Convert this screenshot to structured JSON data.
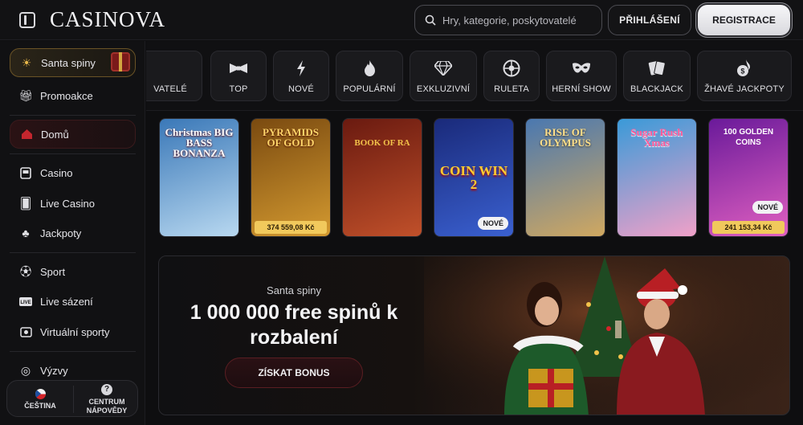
{
  "header": {
    "logo": "CASINOVA",
    "search_placeholder": "Hry, kategorie, poskytovatelé",
    "login_label": "PŘIHLÁŠENÍ",
    "register_label": "REGISTRACE"
  },
  "sidebar": {
    "items": [
      {
        "label": "Santa spiny",
        "icon": "sun-icon"
      },
      {
        "label": "Promoakce",
        "icon": "gift-icon"
      },
      {
        "label": "Domů",
        "icon": "home-icon"
      },
      {
        "label": "Casino",
        "icon": "slot-machine-icon"
      },
      {
        "label": "Live Casino",
        "icon": "live-cards-icon"
      },
      {
        "label": "Jackpoty",
        "icon": "clover-icon"
      },
      {
        "label": "Sport",
        "icon": "soccer-ball-icon"
      },
      {
        "label": "Live sázení",
        "icon": "live-badge-icon"
      },
      {
        "label": "Virtuální sporty",
        "icon": "virtual-sport-icon"
      },
      {
        "label": "Výzvy",
        "icon": "target-icon"
      }
    ],
    "language_label": "ČEŠTINA",
    "help_label_line1": "CENTRUM",
    "help_label_line2": "NÁPOVĚDY"
  },
  "categories": [
    {
      "label": "VATELÉ",
      "icon": "none"
    },
    {
      "label": "TOP",
      "icon": "bowtie-icon"
    },
    {
      "label": "NOVÉ",
      "icon": "lightning-icon"
    },
    {
      "label": "POPULÁRNÍ",
      "icon": "flame-icon"
    },
    {
      "label": "EXKLUZIVNÍ",
      "icon": "diamond-icon"
    },
    {
      "label": "RULETA",
      "icon": "roulette-icon"
    },
    {
      "label": "HERNÍ SHOW",
      "icon": "mask-icon"
    },
    {
      "label": "BLACKJACK",
      "icon": "cards-icon"
    },
    {
      "label": "ŽHAVÉ JACKPOTY",
      "icon": "hot-coin-icon"
    }
  ],
  "games": [
    {
      "title": "Christmas BIG BASS BONANZA",
      "jackpot": "",
      "badge": "",
      "colors": [
        "#3a78b8",
        "#b8d8f0"
      ]
    },
    {
      "title": "PYRAMIDS OF GOLD",
      "jackpot": "374 559,08 Kč",
      "badge": "",
      "colors": [
        "#7a4a10",
        "#d49a30"
      ]
    },
    {
      "title": "BOOK OF RA",
      "jackpot": "",
      "badge": "",
      "colors": [
        "#6a1a10",
        "#c0502a"
      ]
    },
    {
      "title": "COIN WIN 2",
      "jackpot": "",
      "badge": "NOVÉ",
      "colors": [
        "#1a2a7a",
        "#3a60d0"
      ]
    },
    {
      "title": "RISE OF OLYMPUS",
      "jackpot": "",
      "badge": "",
      "colors": [
        "#4a78b0",
        "#d0a860"
      ]
    },
    {
      "title": "Sugar Rush Xmas",
      "jackpot": "",
      "badge": "",
      "colors": [
        "#3a9ad8",
        "#f0a0c8"
      ]
    },
    {
      "title": "100 GOLDEN COINS",
      "jackpot": "241 153,34 Kč",
      "badge": "NOVÉ",
      "colors": [
        "#6a1a9a",
        "#e060c0"
      ]
    }
  ],
  "promo": {
    "subtitle": "Santa spiny",
    "headline": "1 000 000 free spinů k rozbalení",
    "cta": "ZÍSKAT BONUS"
  }
}
